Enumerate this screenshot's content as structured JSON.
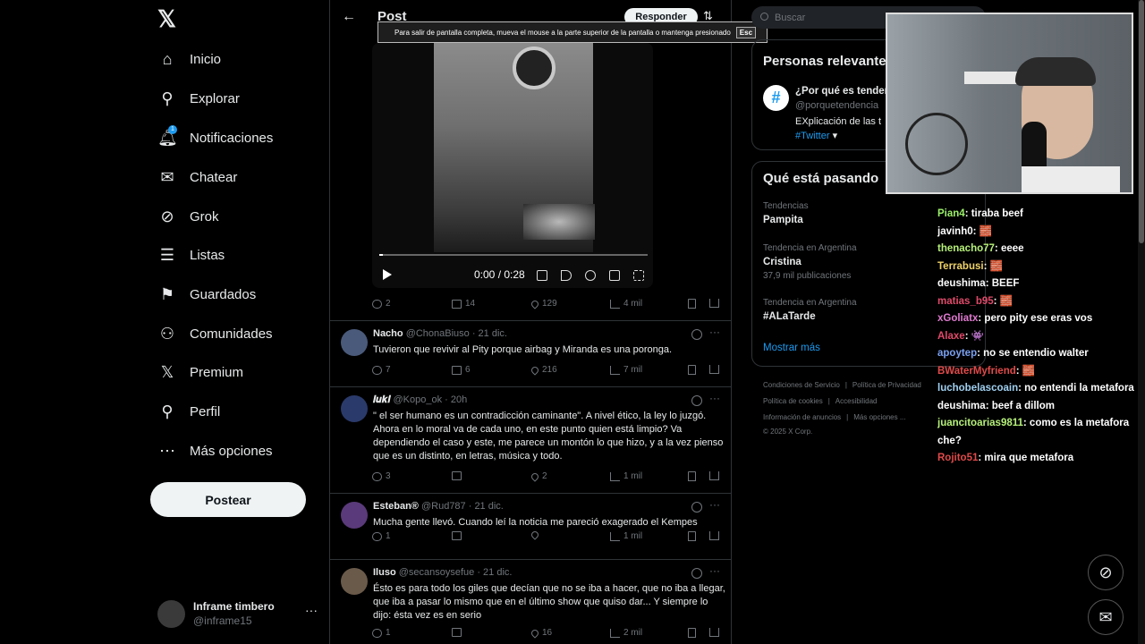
{
  "nav": {
    "logo": "𝕏",
    "items": [
      {
        "label": "Inicio",
        "icon": "home-icon"
      },
      {
        "label": "Explorar",
        "icon": "search-icon"
      },
      {
        "label": "Notificaciones",
        "icon": "bell-icon",
        "badge": "1"
      },
      {
        "label": "Chatear",
        "icon": "mail-icon"
      },
      {
        "label": "Grok",
        "icon": "grok-icon"
      },
      {
        "label": "Listas",
        "icon": "list-icon"
      },
      {
        "label": "Guardados",
        "icon": "bookmark-icon"
      },
      {
        "label": "Comunidades",
        "icon": "people-icon"
      },
      {
        "label": "Premium",
        "icon": "x-icon"
      },
      {
        "label": "Perfil",
        "icon": "person-icon"
      },
      {
        "label": "Más opciones",
        "icon": "more-circle-icon"
      }
    ],
    "post_button": "Postear",
    "account": {
      "name": "Inframe timbero",
      "handle": "@inframe15",
      "more": "···"
    }
  },
  "header": {
    "title": "Post",
    "reply_button": "Responder"
  },
  "fullscreen_banner": {
    "text": "Para salir de pantalla completa, mueva el mouse a la parte superior de la pantalla o mantenga presionado",
    "key": "Esc"
  },
  "video": {
    "time": "0:00 / 0:28"
  },
  "main_post_actions": {
    "replies": "2",
    "reposts": "14",
    "likes": "129",
    "views": "4 mil"
  },
  "replies": [
    {
      "name": "Nacho",
      "handle": "@ChonaBiuso · 21 dic.",
      "text": "Tuvieron que revivir al Pity porque airbag y Miranda es una poronga.",
      "replies": "7",
      "reposts": "6",
      "likes": "216",
      "views": "7 mil",
      "avatar_color": "#4a5a7a"
    },
    {
      "name": "𝒍𝒖𝒌𝒊",
      "handle": "@Kopo_ok · 20h",
      "text": "\" el ser humano es un contradicción caminante\". A nivel ético, la ley lo juzgó. Ahora en lo moral va de cada uno, en este punto quien está limpio? Va dependiendo el caso y este, me parece un montón lo que hizo, y a la vez pienso que es un distinto, en letras, música y todo.",
      "replies": "3",
      "reposts": "",
      "likes": "2",
      "views": "1 mil",
      "avatar_color": "#2a3a6a"
    },
    {
      "name": "Esteban®",
      "handle": "@Rud787 · 21 dic.",
      "text": "Mucha gente llevó. Cuando leí la noticia me pareció exagerado el Kempes",
      "replies": "1",
      "reposts": "",
      "likes": "",
      "views": "1 mil",
      "avatar_color": "#5a3a7a"
    },
    {
      "name": "Iluso",
      "handle": "@secansoysefue · 21 dic.",
      "text": "Ésto es para todo los giles que decían que no se iba a hacer, que no iba a llegar, que iba a pasar lo mismo que en el último show que quiso dar... Y siempre lo dijo: ésta vez es en serio",
      "replies": "1",
      "reposts": "",
      "likes": "16",
      "views": "2 mil",
      "avatar_color": "#6a5a4a"
    }
  ],
  "right": {
    "search_placeholder": "Buscar",
    "relevant_title": "Personas relevantes",
    "relevant": {
      "name": "¿Por qué es tenden",
      "handle": "@porquetendencia",
      "bio": "EXplicación de las t",
      "tag": "#Twitter"
    },
    "trending_title": "Qué está pasando",
    "trends": [
      {
        "category": "Tendencias",
        "name": "Pampita",
        "posts": ""
      },
      {
        "category": "Tendencia en Argentina",
        "name": "Cristina",
        "posts": "37,9 mil publicaciones"
      },
      {
        "category": "Tendencia en Argentina",
        "name": "#ALaTarde",
        "posts": ""
      }
    ],
    "show_more": "Mostrar más",
    "footer": [
      "Condiciones de Servicio",
      "Política de Privacidad",
      "Política de cookies",
      "Accesibilidad",
      "Información de anuncios",
      "Más opciones ...",
      "© 2025 X Corp."
    ]
  },
  "chat": [
    {
      "user": "Pian4",
      "color": "#9cf06a",
      "msg": ": tiraba beef"
    },
    {
      "user": "javinh0",
      "color": "#ffffff",
      "msg": ": 🧱"
    },
    {
      "user": "thenacho77",
      "color": "#b6f07a",
      "msg": ": eeee"
    },
    {
      "user": "Terrabusi",
      "color": "#f0d36a",
      "msg": ": 🧱"
    },
    {
      "user": "deushima",
      "color": "#ffffff",
      "msg": ": BEEF"
    },
    {
      "user": "matias_b95",
      "color": "#e04a6a",
      "msg": ": 🧱"
    },
    {
      "user": "xGoliatx",
      "color": "#e07ad0",
      "msg": ": pero pity ese eras vos"
    },
    {
      "user": "Alaxe",
      "color": "#e04a6a",
      "msg": ": 👾"
    },
    {
      "user": "apoytep",
      "color": "#7aa0f0",
      "msg": ": no se entendio walter"
    },
    {
      "user": "BWaterMyfriend",
      "color": "#e04a4a",
      "msg": ": 🧱"
    },
    {
      "user": "luchobelascoain",
      "color": "#a0d0f0",
      "msg": ": no entendi la metafora"
    },
    {
      "user": "deushima",
      "color": "#ffffff",
      "msg": ": beef a dillom"
    },
    {
      "user": "juancitoarias9811",
      "color": "#b6f07a",
      "msg": ": como es la metafora che?"
    },
    {
      "user": "Rojito51",
      "color": "#e04a4a",
      "msg": ": mira que metafora"
    }
  ]
}
